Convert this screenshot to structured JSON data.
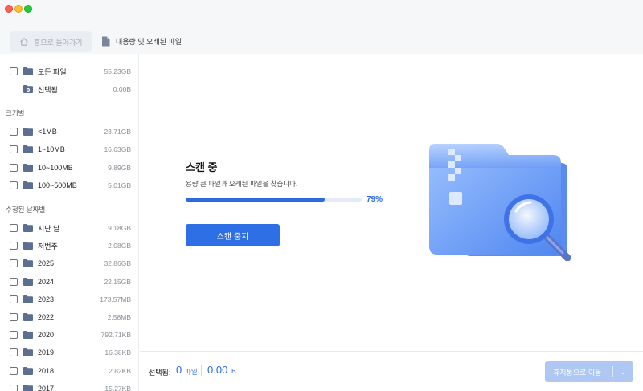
{
  "toolbar": {
    "home_label": "홈으로 돌아가기",
    "breadcrumb_label": "대용량 및 오래된 파일"
  },
  "sidebar": {
    "top_items": [
      {
        "label": "모든 파일",
        "size": "55.23GB",
        "checkbox": true
      },
      {
        "label": "선택됨",
        "size": "0.00B",
        "checkbox": false
      }
    ],
    "size_section_title": "크기별",
    "size_items": [
      {
        "label": "<1MB",
        "size": "23.71GB"
      },
      {
        "label": "1~10MB",
        "size": "16.63GB"
      },
      {
        "label": "10~100MB",
        "size": "9.89GB"
      },
      {
        "label": "100~500MB",
        "size": "5.01GB"
      }
    ],
    "date_section_title": "수정된 날짜별",
    "date_items": [
      {
        "label": "지난 달",
        "size": "9.18GB"
      },
      {
        "label": "저번주",
        "size": "2.08GB"
      },
      {
        "label": "2025",
        "size": "32.86GB"
      },
      {
        "label": "2024",
        "size": "22.15GB"
      },
      {
        "label": "2023",
        "size": "173.57MB"
      },
      {
        "label": "2022",
        "size": "2.58MB"
      },
      {
        "label": "2020",
        "size": "792.71KB"
      },
      {
        "label": "2019",
        "size": "16.38KB"
      },
      {
        "label": "2018",
        "size": "2.82KB"
      },
      {
        "label": "2017",
        "size": "15.27KB"
      }
    ]
  },
  "scan": {
    "title": "스캔 중",
    "description": "용량 큰 파일과 오래된 파일을 찾습니다.",
    "progress": 0.79,
    "progress_label": "79%",
    "stop_label": "스캔 중지"
  },
  "footer": {
    "selected_label": "선택됨:",
    "selected_count": "0",
    "selected_unit": "파일",
    "selected_size": "0.00",
    "selected_size_unit": "B",
    "trash_label": "휴지통으로 이동"
  },
  "colors": {
    "accent": "#2d6ae0",
    "button": "#2f6fe5",
    "button_disabled": "#aec7f3",
    "folder_icon": "#5b6f8f"
  },
  "icons": {
    "home": "home-icon",
    "breadcrumb": "document-icon",
    "folder": "folder-icon",
    "selected": "gear-folder-icon",
    "dropdown": "chevron-down-icon",
    "illustration": "folder-magnifier-icon"
  }
}
